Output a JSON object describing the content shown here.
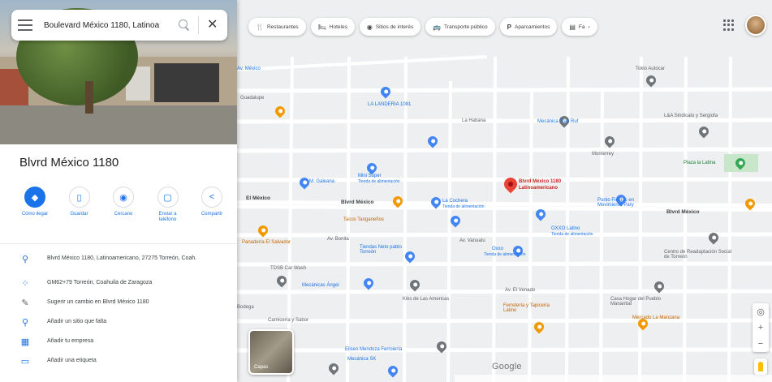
{
  "search": {
    "value": "Boulevard México 1180, Latinoa",
    "placeholder": "Buscar en Google Maps"
  },
  "place": {
    "title": "Blvrd México 1180"
  },
  "actions": [
    {
      "label": "Cómo llegar",
      "icon": "directions-icon"
    },
    {
      "label": "Guardar",
      "icon": "bookmark-icon"
    },
    {
      "label": "Cercano",
      "icon": "nearby-icon"
    },
    {
      "label": "Enviar a teléfono",
      "icon": "phone-icon"
    },
    {
      "label": "Compartir",
      "icon": "share-icon"
    }
  ],
  "info": [
    {
      "icon": "location-pin-icon",
      "text": "Blvrd México 1180, Latinoamericano, 27275 Torreón, Coah."
    },
    {
      "icon": "plus-code-icon",
      "text": "GM62+79 Torreón, Coahuila de Zaragoza"
    },
    {
      "icon": "pencil-icon",
      "text": "Sugerir un cambio en Blvrd México 1180"
    },
    {
      "icon": "add-place-icon",
      "text": "Añadir un sitio que falta"
    },
    {
      "icon": "business-icon",
      "text": "Añadir tu empresa"
    },
    {
      "icon": "label-icon",
      "text": "Añadir una etiqueta"
    }
  ],
  "chips": [
    {
      "icon": "restaurant-icon",
      "label": "Restaurantes"
    },
    {
      "icon": "hotel-icon",
      "label": "Hoteles"
    },
    {
      "icon": "camera-icon",
      "label": "Sitios de interés"
    },
    {
      "icon": "transit-icon",
      "label": "Transporte público"
    },
    {
      "icon": "parking-icon",
      "label": "Aparcamientos"
    },
    {
      "icon": "more-icon",
      "label": "Fa"
    }
  ],
  "map_labels": {
    "selected": "Blvrd México 1180 Latinoamericano",
    "la_lavanderia": "LA LANDERIA 1081",
    "la_habana_top": "Tokio Autocar",
    "lands": "L&A Sindicato y Sergiofa",
    "mecanica": "Mecánica Tran Ruf",
    "plaza": "Plaza la Latina",
    "mini_super": "Mini Super",
    "mini_super_sub": "Tienda de alimentación",
    "m_galeana": "M. Galeana",
    "blvd_mexico_left": "Blvrd México",
    "blvd_mexico_right": "Blvrd México",
    "el_mexico": "El México",
    "la_cochera": "La Cochera",
    "la_cochera_sub": "Tienda de alimentación",
    "tacos_tanganeños": "Tacos Tanganeños",
    "punto_fiestas": "Punto Fiestas en Movimiento Pary",
    "oxxo_latino": "OXXO Latino",
    "oxxo_latino_sub": "Tienda de alimentación",
    "panaderia": "Panadería El Salvador",
    "tiendas_neto": "Tiendas Neto pablo Torreón",
    "oxxo2": "Oxxo",
    "oxxo2_sub": "Tienda de alimentación",
    "tdsb": "TDSB Car Wash",
    "centro_readap": "Centro de Readaptación Social de Torreón",
    "mecanicas": "Mecánicas Ángel",
    "kiks": "Kiks de Las Americas",
    "casa_hogar": "Casa Hogar del Pueblo Manantial",
    "mercado": "Mercado La Manzana",
    "ferreteria": "Ferretería y Tapicería Latino",
    "bodega": "Bodega",
    "eliseo": "Eliseo Mendoza Ferroiería",
    "mecanica_sk": "Mecánica SK",
    "carniceria": "Carnicería y Sabor",
    "av_bonita": "Av. Bonita",
    "av_vanuatu": "Av. Vanuatu",
    "av_el_venado": "Av. El Venado",
    "av_mexico": "Av. México",
    "monterrey": "Monterrey",
    "la_habana": "La Habana",
    "guadalupe": "Guadalupe"
  },
  "map_controls": {
    "google": "Google",
    "layers": "Capas",
    "zoom_in": "+",
    "zoom_out": "−"
  }
}
